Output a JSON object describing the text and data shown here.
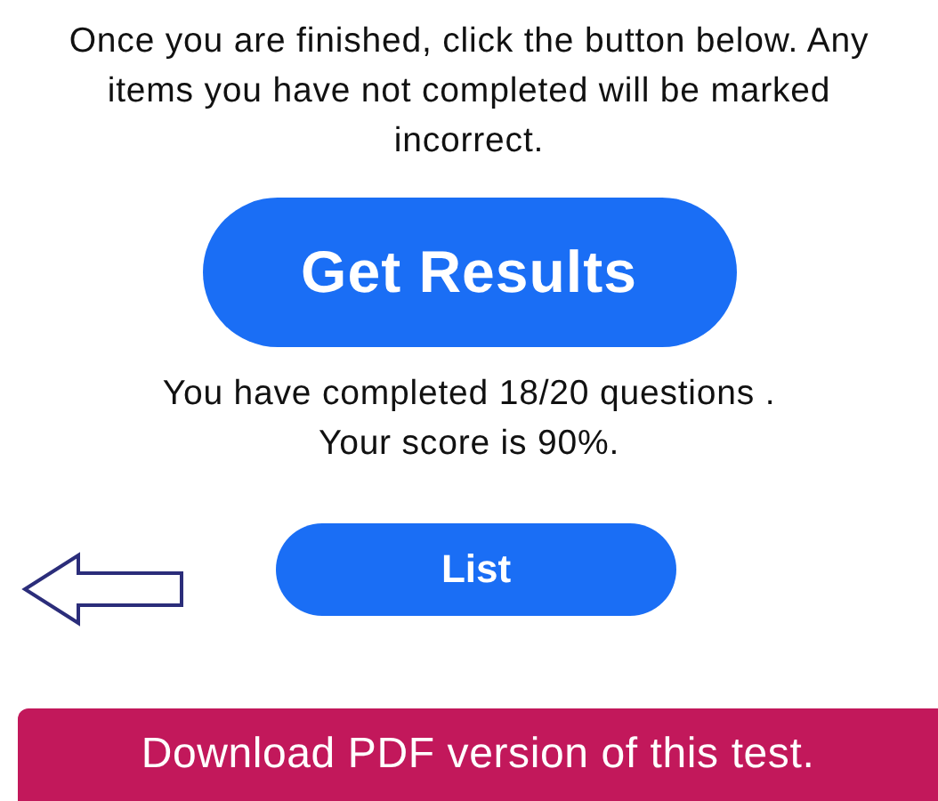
{
  "instructions": "Once you are finished, click the button below. Any items you have not completed will be marked incorrect.",
  "primary_button": {
    "label": "Get Results"
  },
  "summary_lines": [
    "You have completed 18/20 questions .",
    "Your score is 90%."
  ],
  "list_button": {
    "label": "List"
  },
  "download_bar": {
    "label": "Download PDF version of this test."
  }
}
